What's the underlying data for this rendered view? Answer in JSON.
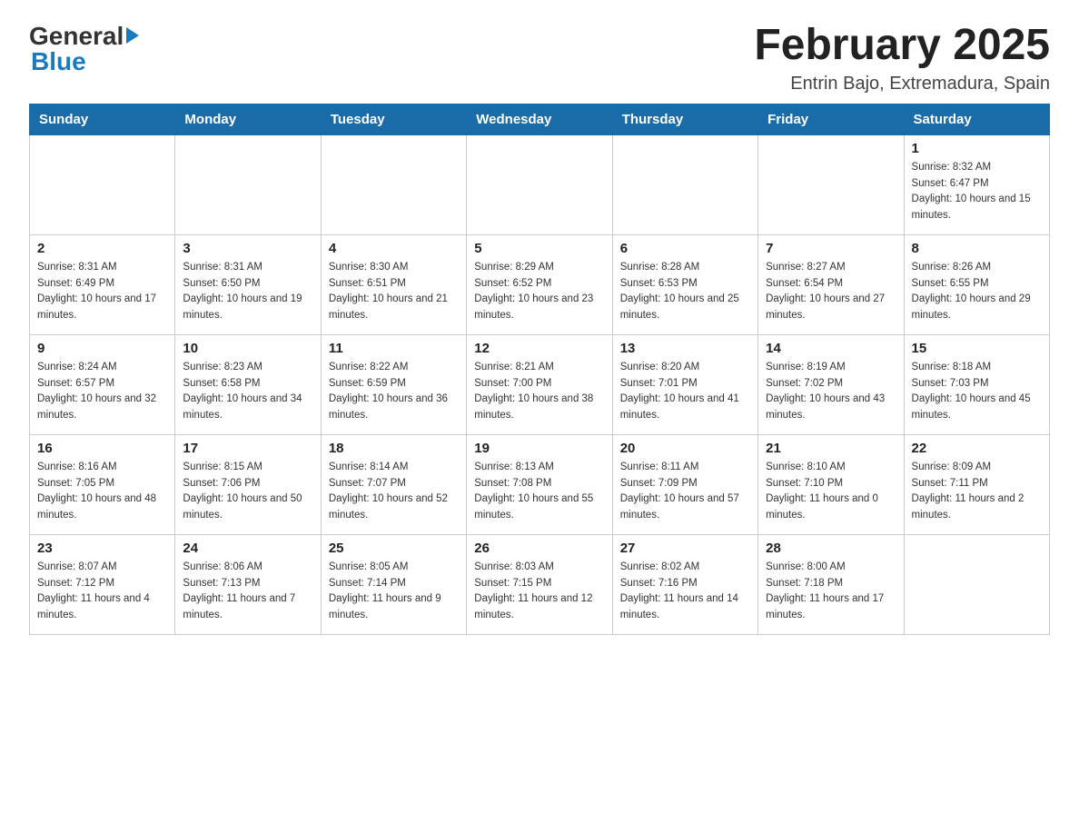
{
  "header": {
    "title": "February 2025",
    "subtitle": "Entrin Bajo, Extremadura, Spain"
  },
  "logo": {
    "general": "General",
    "blue": "Blue"
  },
  "days_of_week": [
    "Sunday",
    "Monday",
    "Tuesday",
    "Wednesday",
    "Thursday",
    "Friday",
    "Saturday"
  ],
  "weeks": [
    [
      {
        "day": "",
        "info": ""
      },
      {
        "day": "",
        "info": ""
      },
      {
        "day": "",
        "info": ""
      },
      {
        "day": "",
        "info": ""
      },
      {
        "day": "",
        "info": ""
      },
      {
        "day": "",
        "info": ""
      },
      {
        "day": "1",
        "info": "Sunrise: 8:32 AM\nSunset: 6:47 PM\nDaylight: 10 hours and 15 minutes."
      }
    ],
    [
      {
        "day": "2",
        "info": "Sunrise: 8:31 AM\nSunset: 6:49 PM\nDaylight: 10 hours and 17 minutes."
      },
      {
        "day": "3",
        "info": "Sunrise: 8:31 AM\nSunset: 6:50 PM\nDaylight: 10 hours and 19 minutes."
      },
      {
        "day": "4",
        "info": "Sunrise: 8:30 AM\nSunset: 6:51 PM\nDaylight: 10 hours and 21 minutes."
      },
      {
        "day": "5",
        "info": "Sunrise: 8:29 AM\nSunset: 6:52 PM\nDaylight: 10 hours and 23 minutes."
      },
      {
        "day": "6",
        "info": "Sunrise: 8:28 AM\nSunset: 6:53 PM\nDaylight: 10 hours and 25 minutes."
      },
      {
        "day": "7",
        "info": "Sunrise: 8:27 AM\nSunset: 6:54 PM\nDaylight: 10 hours and 27 minutes."
      },
      {
        "day": "8",
        "info": "Sunrise: 8:26 AM\nSunset: 6:55 PM\nDaylight: 10 hours and 29 minutes."
      }
    ],
    [
      {
        "day": "9",
        "info": "Sunrise: 8:24 AM\nSunset: 6:57 PM\nDaylight: 10 hours and 32 minutes."
      },
      {
        "day": "10",
        "info": "Sunrise: 8:23 AM\nSunset: 6:58 PM\nDaylight: 10 hours and 34 minutes."
      },
      {
        "day": "11",
        "info": "Sunrise: 8:22 AM\nSunset: 6:59 PM\nDaylight: 10 hours and 36 minutes."
      },
      {
        "day": "12",
        "info": "Sunrise: 8:21 AM\nSunset: 7:00 PM\nDaylight: 10 hours and 38 minutes."
      },
      {
        "day": "13",
        "info": "Sunrise: 8:20 AM\nSunset: 7:01 PM\nDaylight: 10 hours and 41 minutes."
      },
      {
        "day": "14",
        "info": "Sunrise: 8:19 AM\nSunset: 7:02 PM\nDaylight: 10 hours and 43 minutes."
      },
      {
        "day": "15",
        "info": "Sunrise: 8:18 AM\nSunset: 7:03 PM\nDaylight: 10 hours and 45 minutes."
      }
    ],
    [
      {
        "day": "16",
        "info": "Sunrise: 8:16 AM\nSunset: 7:05 PM\nDaylight: 10 hours and 48 minutes."
      },
      {
        "day": "17",
        "info": "Sunrise: 8:15 AM\nSunset: 7:06 PM\nDaylight: 10 hours and 50 minutes."
      },
      {
        "day": "18",
        "info": "Sunrise: 8:14 AM\nSunset: 7:07 PM\nDaylight: 10 hours and 52 minutes."
      },
      {
        "day": "19",
        "info": "Sunrise: 8:13 AM\nSunset: 7:08 PM\nDaylight: 10 hours and 55 minutes."
      },
      {
        "day": "20",
        "info": "Sunrise: 8:11 AM\nSunset: 7:09 PM\nDaylight: 10 hours and 57 minutes."
      },
      {
        "day": "21",
        "info": "Sunrise: 8:10 AM\nSunset: 7:10 PM\nDaylight: 11 hours and 0 minutes."
      },
      {
        "day": "22",
        "info": "Sunrise: 8:09 AM\nSunset: 7:11 PM\nDaylight: 11 hours and 2 minutes."
      }
    ],
    [
      {
        "day": "23",
        "info": "Sunrise: 8:07 AM\nSunset: 7:12 PM\nDaylight: 11 hours and 4 minutes."
      },
      {
        "day": "24",
        "info": "Sunrise: 8:06 AM\nSunset: 7:13 PM\nDaylight: 11 hours and 7 minutes."
      },
      {
        "day": "25",
        "info": "Sunrise: 8:05 AM\nSunset: 7:14 PM\nDaylight: 11 hours and 9 minutes."
      },
      {
        "day": "26",
        "info": "Sunrise: 8:03 AM\nSunset: 7:15 PM\nDaylight: 11 hours and 12 minutes."
      },
      {
        "day": "27",
        "info": "Sunrise: 8:02 AM\nSunset: 7:16 PM\nDaylight: 11 hours and 14 minutes."
      },
      {
        "day": "28",
        "info": "Sunrise: 8:00 AM\nSunset: 7:18 PM\nDaylight: 11 hours and 17 minutes."
      },
      {
        "day": "",
        "info": ""
      }
    ]
  ]
}
